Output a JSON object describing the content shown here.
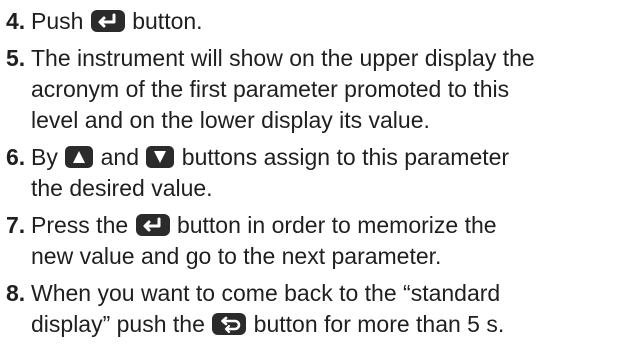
{
  "steps": [
    {
      "number": "4.",
      "lines": [
        {
          "before": "Push",
          "icon": "enter-key",
          "after": "button."
        }
      ]
    },
    {
      "number": "5.",
      "lines": [
        {
          "text": "The instrument will show on the upper display the"
        },
        {
          "text": "acronym of the first parameter promoted to this"
        },
        {
          "text": "level and on the lower display its value."
        }
      ]
    },
    {
      "number": "6.",
      "lines": [
        {
          "before": "By",
          "icon": "up-arrow-key",
          "middle": "and",
          "icon2": "down-arrow-key",
          "after": "buttons assign to this parameter"
        },
        {
          "text": "the desired value."
        }
      ]
    },
    {
      "number": "7.",
      "lines": [
        {
          "before": "Press the",
          "icon": "enter-key",
          "after": "button in order to memorize the"
        },
        {
          "text": "new value and go to the next parameter."
        }
      ]
    },
    {
      "number": "8.",
      "lines": [
        {
          "text": "When you want to come back to the “standard"
        },
        {
          "before": "display” push the",
          "icon": "loop-key",
          "after": "button for more than 5 s."
        }
      ]
    }
  ],
  "icons": {
    "key_fill": "#2b2b2b",
    "symbol_color": "#ffffff"
  }
}
